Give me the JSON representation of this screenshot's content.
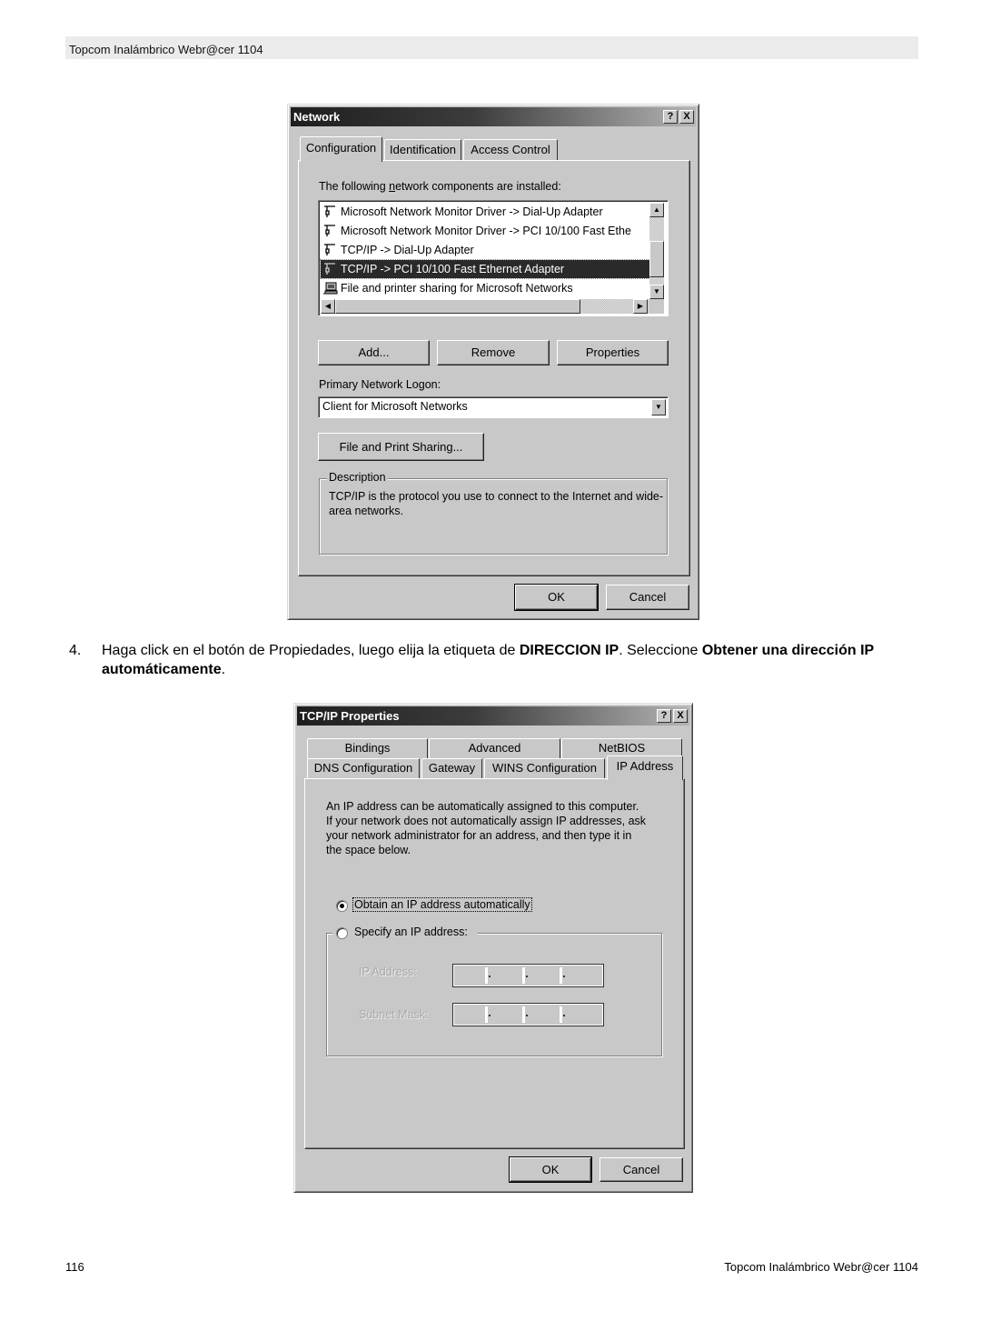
{
  "header": {
    "title": "Topcom Inalámbrico Webr@cer 1104"
  },
  "footer": {
    "page_number": "116",
    "title": "Topcom Inalámbrico Webr@cer 1104"
  },
  "network_dialog": {
    "title": "Network",
    "help_button": "?",
    "close_button": "X",
    "tabs": [
      {
        "label": "Configuration",
        "active": true
      },
      {
        "label": "Identification",
        "active": false
      },
      {
        "label": "Access Control",
        "active": false
      }
    ],
    "components_label": "The following network components are installed:",
    "components": [
      {
        "label": "Microsoft Network Monitor Driver -> Dial-Up Adapter",
        "icon": "network-adapter-icon",
        "selected": false
      },
      {
        "label": "Microsoft Network Monitor Driver -> PCI 10/100 Fast Ethe",
        "icon": "network-adapter-icon",
        "selected": false
      },
      {
        "label": "TCP/IP -> Dial-Up Adapter",
        "icon": "network-adapter-icon",
        "selected": false
      },
      {
        "label": "TCP/IP -> PCI 10/100 Fast Ethernet Adapter",
        "icon": "network-adapter-icon",
        "selected": true
      },
      {
        "label": "File and printer sharing for Microsoft Networks",
        "icon": "computer-share-icon",
        "selected": false
      }
    ],
    "buttons": {
      "add": "Add...",
      "remove": "Remove",
      "properties": "Properties"
    },
    "logon_label": "Primary Network Logon:",
    "logon_value": "Client for Microsoft Networks",
    "file_print_button": "File and Print Sharing...",
    "description_label": "Description",
    "description_text": "TCP/IP is the protocol you use to connect to the Internet and wide-area networks.",
    "ok": "OK",
    "cancel": "Cancel"
  },
  "step": {
    "number": "4.",
    "text_1": "Haga click en el botón de Propiedades, luego elija la etiqueta de ",
    "bold_1": "DIRECCION IP",
    "text_2": ". Seleccione ",
    "bold_2": "Obtener una dirección IP automáticamente",
    "text_3": "."
  },
  "tcpip_dialog": {
    "title": "TCP/IP Properties",
    "help_button": "?",
    "close_button": "X",
    "tabs_back": [
      {
        "label": "Bindings"
      },
      {
        "label": "Advanced"
      },
      {
        "label": "NetBIOS"
      }
    ],
    "tabs_front": [
      {
        "label": "DNS Configuration",
        "active": false
      },
      {
        "label": "Gateway",
        "active": false
      },
      {
        "label": "WINS Configuration",
        "active": false
      },
      {
        "label": "IP Address",
        "active": true
      }
    ],
    "info_text": [
      "An IP address can be automatically assigned to this computer.",
      "If your network does not automatically assign IP addresses, ask",
      "your network administrator for an address, and then type it in",
      "the space below."
    ],
    "radio_obtain": {
      "label": "Obtain an IP address automatically",
      "checked": true
    },
    "radio_specify": {
      "label": "Specify an IP address:",
      "checked": false
    },
    "ip_address_label": "IP Address:",
    "subnet_mask_label": "Subnet Mask:",
    "ip_address_value": [
      "",
      "",
      "",
      ""
    ],
    "subnet_mask_value": [
      "",
      "",
      "",
      ""
    ],
    "ok": "OK",
    "cancel": "Cancel"
  }
}
